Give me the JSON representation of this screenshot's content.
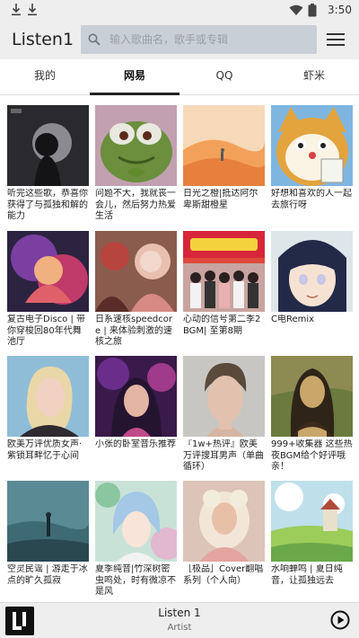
{
  "status_bar": {
    "time": "3:50"
  },
  "app_bar": {
    "title": "Listen1",
    "search_placeholder": "输入歌曲名，歌手或专辑"
  },
  "tabs": [
    {
      "label": "我的",
      "active": false
    },
    {
      "label": "网易",
      "active": true
    },
    {
      "label": "QQ",
      "active": false
    },
    {
      "label": "虾米",
      "active": false
    }
  ],
  "playlists": [
    {
      "title": "听完这些歌，恭喜你获得了与孤独和解的能力"
    },
    {
      "title": "问题不大，我就丧一会儿，然后努力热爱生活"
    },
    {
      "title": "日光之橙|抵达阿尔卑斯甜橙星"
    },
    {
      "title": "好想和喜欢的人一起去旅行呀"
    },
    {
      "title": "复古电子Disco | 带你穿梭回80年代舞池厅"
    },
    {
      "title": "日系速核speedcore | 来体验刺激的速核之旅"
    },
    {
      "title": "心动的信号第二季2　BGM| 至第8期"
    },
    {
      "title": "C电Remix"
    },
    {
      "title": "欧美万评优质女声·紫锁耳畔忆于心间"
    },
    {
      "title": "小张的卧室音乐推荐"
    },
    {
      "title": "『1w+热评』欧美万评搜耳男声（单曲循环）"
    },
    {
      "title": "999+收集器 这些热夜BGM给个好评哦亲！"
    },
    {
      "title": "空灵民谣 | 游走于冰点的旷久孤寂"
    },
    {
      "title": "夏季纯音|竹深树密虫鸣处，时有微凉不是风"
    },
    {
      "title": "［极品］Cover翻唱系列（个人向）"
    },
    {
      "title": "水响蝉鸣 | 夏日纯音，让孤独远去"
    }
  ],
  "player": {
    "track": "Listen 1",
    "artist": "Artist"
  },
  "colors": {
    "bar_bg": "#eeeeee",
    "search_bg": "#c9cfd6",
    "active_tab_indicator": "#222222"
  }
}
